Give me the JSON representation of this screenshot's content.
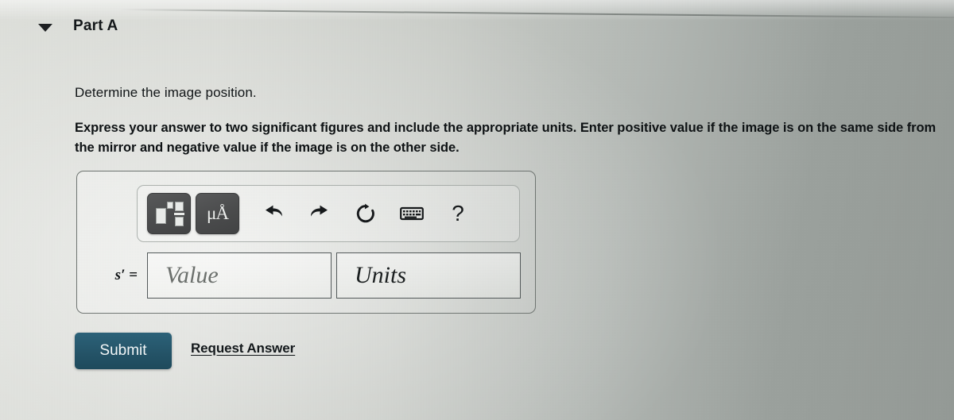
{
  "part": {
    "caret_icon": "caret-down-icon",
    "title": "Part A"
  },
  "question": {
    "prompt": "Determine the image position.",
    "instruction": "Express your answer to two significant figures and include the appropriate units. Enter positive value if the image is on the same side from the mirror and negative value if the image is on the other side."
  },
  "toolbar": {
    "buttons": [
      {
        "name": "math-template-button",
        "icon": "math-template-icon",
        "label": ""
      },
      {
        "name": "units-button",
        "icon": "micro-angstrom-icon",
        "label": "μÅ"
      }
    ],
    "icons": [
      {
        "name": "undo-icon",
        "glyph": "↰"
      },
      {
        "name": "redo-icon",
        "glyph": "↱"
      },
      {
        "name": "reset-icon",
        "glyph": "↻"
      },
      {
        "name": "keyboard-icon",
        "glyph": "⌨"
      },
      {
        "name": "help-icon",
        "glyph": "?"
      }
    ]
  },
  "answer": {
    "variable_label": "s′ =",
    "value_placeholder": "Value",
    "units_placeholder": "Units"
  },
  "actions": {
    "submit_label": "Submit",
    "request_answer_label": "Request Answer"
  },
  "colors": {
    "submit_button": "#245367",
    "toolbar_button": "#4a4b4c",
    "text": "#121618",
    "background": "#c9ccc7"
  }
}
